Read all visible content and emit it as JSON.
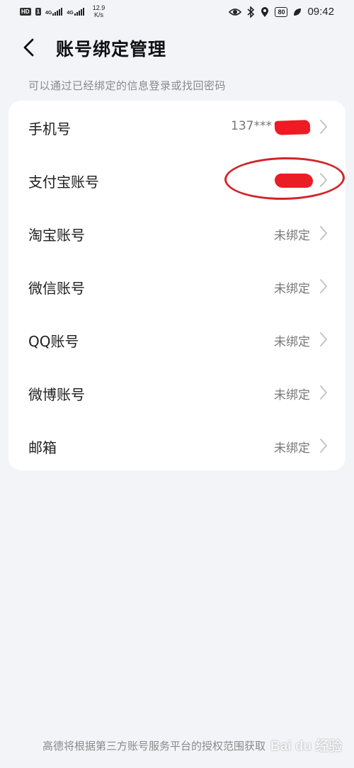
{
  "status_bar": {
    "hd_badge": "HD",
    "sim1": "1",
    "net1": "4G",
    "net2": "4G",
    "speed_value": "12.9",
    "speed_unit": "K/s",
    "battery": "80",
    "time": "09:42"
  },
  "header": {
    "title": "账号绑定管理"
  },
  "hint": "可以通过已经绑定的信息登录或找回密码",
  "rows": [
    {
      "label": "手机号",
      "value": "137***"
    },
    {
      "label": "支付宝账号",
      "value": ""
    },
    {
      "label": "淘宝账号",
      "value": "未绑定"
    },
    {
      "label": "微信账号",
      "value": "未绑定"
    },
    {
      "label": "QQ账号",
      "value": "未绑定"
    },
    {
      "label": "微博账号",
      "value": "未绑定"
    },
    {
      "label": "邮箱",
      "value": "未绑定"
    }
  ],
  "footer_note": "高德将根据第三方账号服务平台的授权范围获取",
  "watermark": "Bai du 经验",
  "colors": {
    "background": "#f3f4f8",
    "card": "#ffffff",
    "redaction": "#ee1b24",
    "annotation_circle": "#d4232a"
  },
  "icons": [
    "back-arrow-icon",
    "chevron-right-icon",
    "eye-icon",
    "bluetooth-icon",
    "location-icon",
    "battery-icon",
    "leaf-icon"
  ]
}
